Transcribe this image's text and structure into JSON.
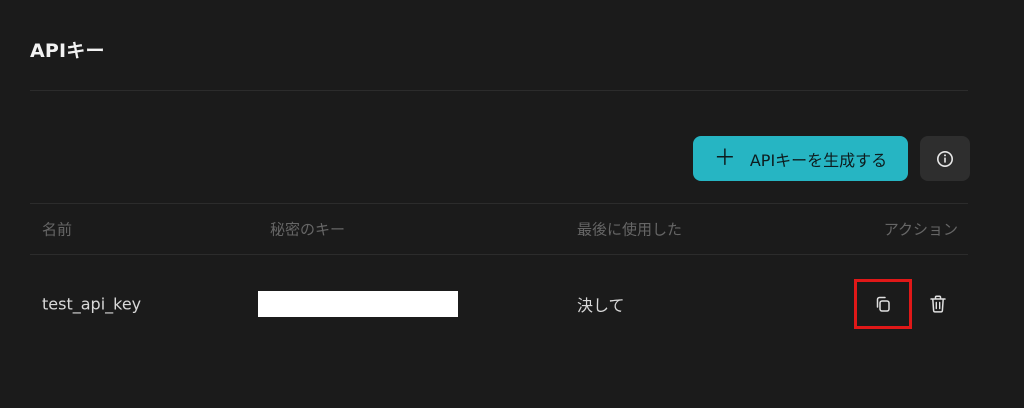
{
  "page": {
    "title": "APIキー"
  },
  "toolbar": {
    "create_label": "APIキーを生成する",
    "create_icon": "plus-icon",
    "info_icon": "info-icon"
  },
  "table": {
    "columns": [
      "名前",
      "秘密のキー",
      "最後に使用した",
      "アクション"
    ],
    "rows": [
      {
        "name": "test_api_key",
        "secret": "",
        "last_used": "決して",
        "actions": [
          "copy-icon",
          "trash-icon"
        ]
      }
    ]
  },
  "colors": {
    "background": "#1b1b1b",
    "accent": "#26b5c3",
    "highlight": "#e01818"
  }
}
